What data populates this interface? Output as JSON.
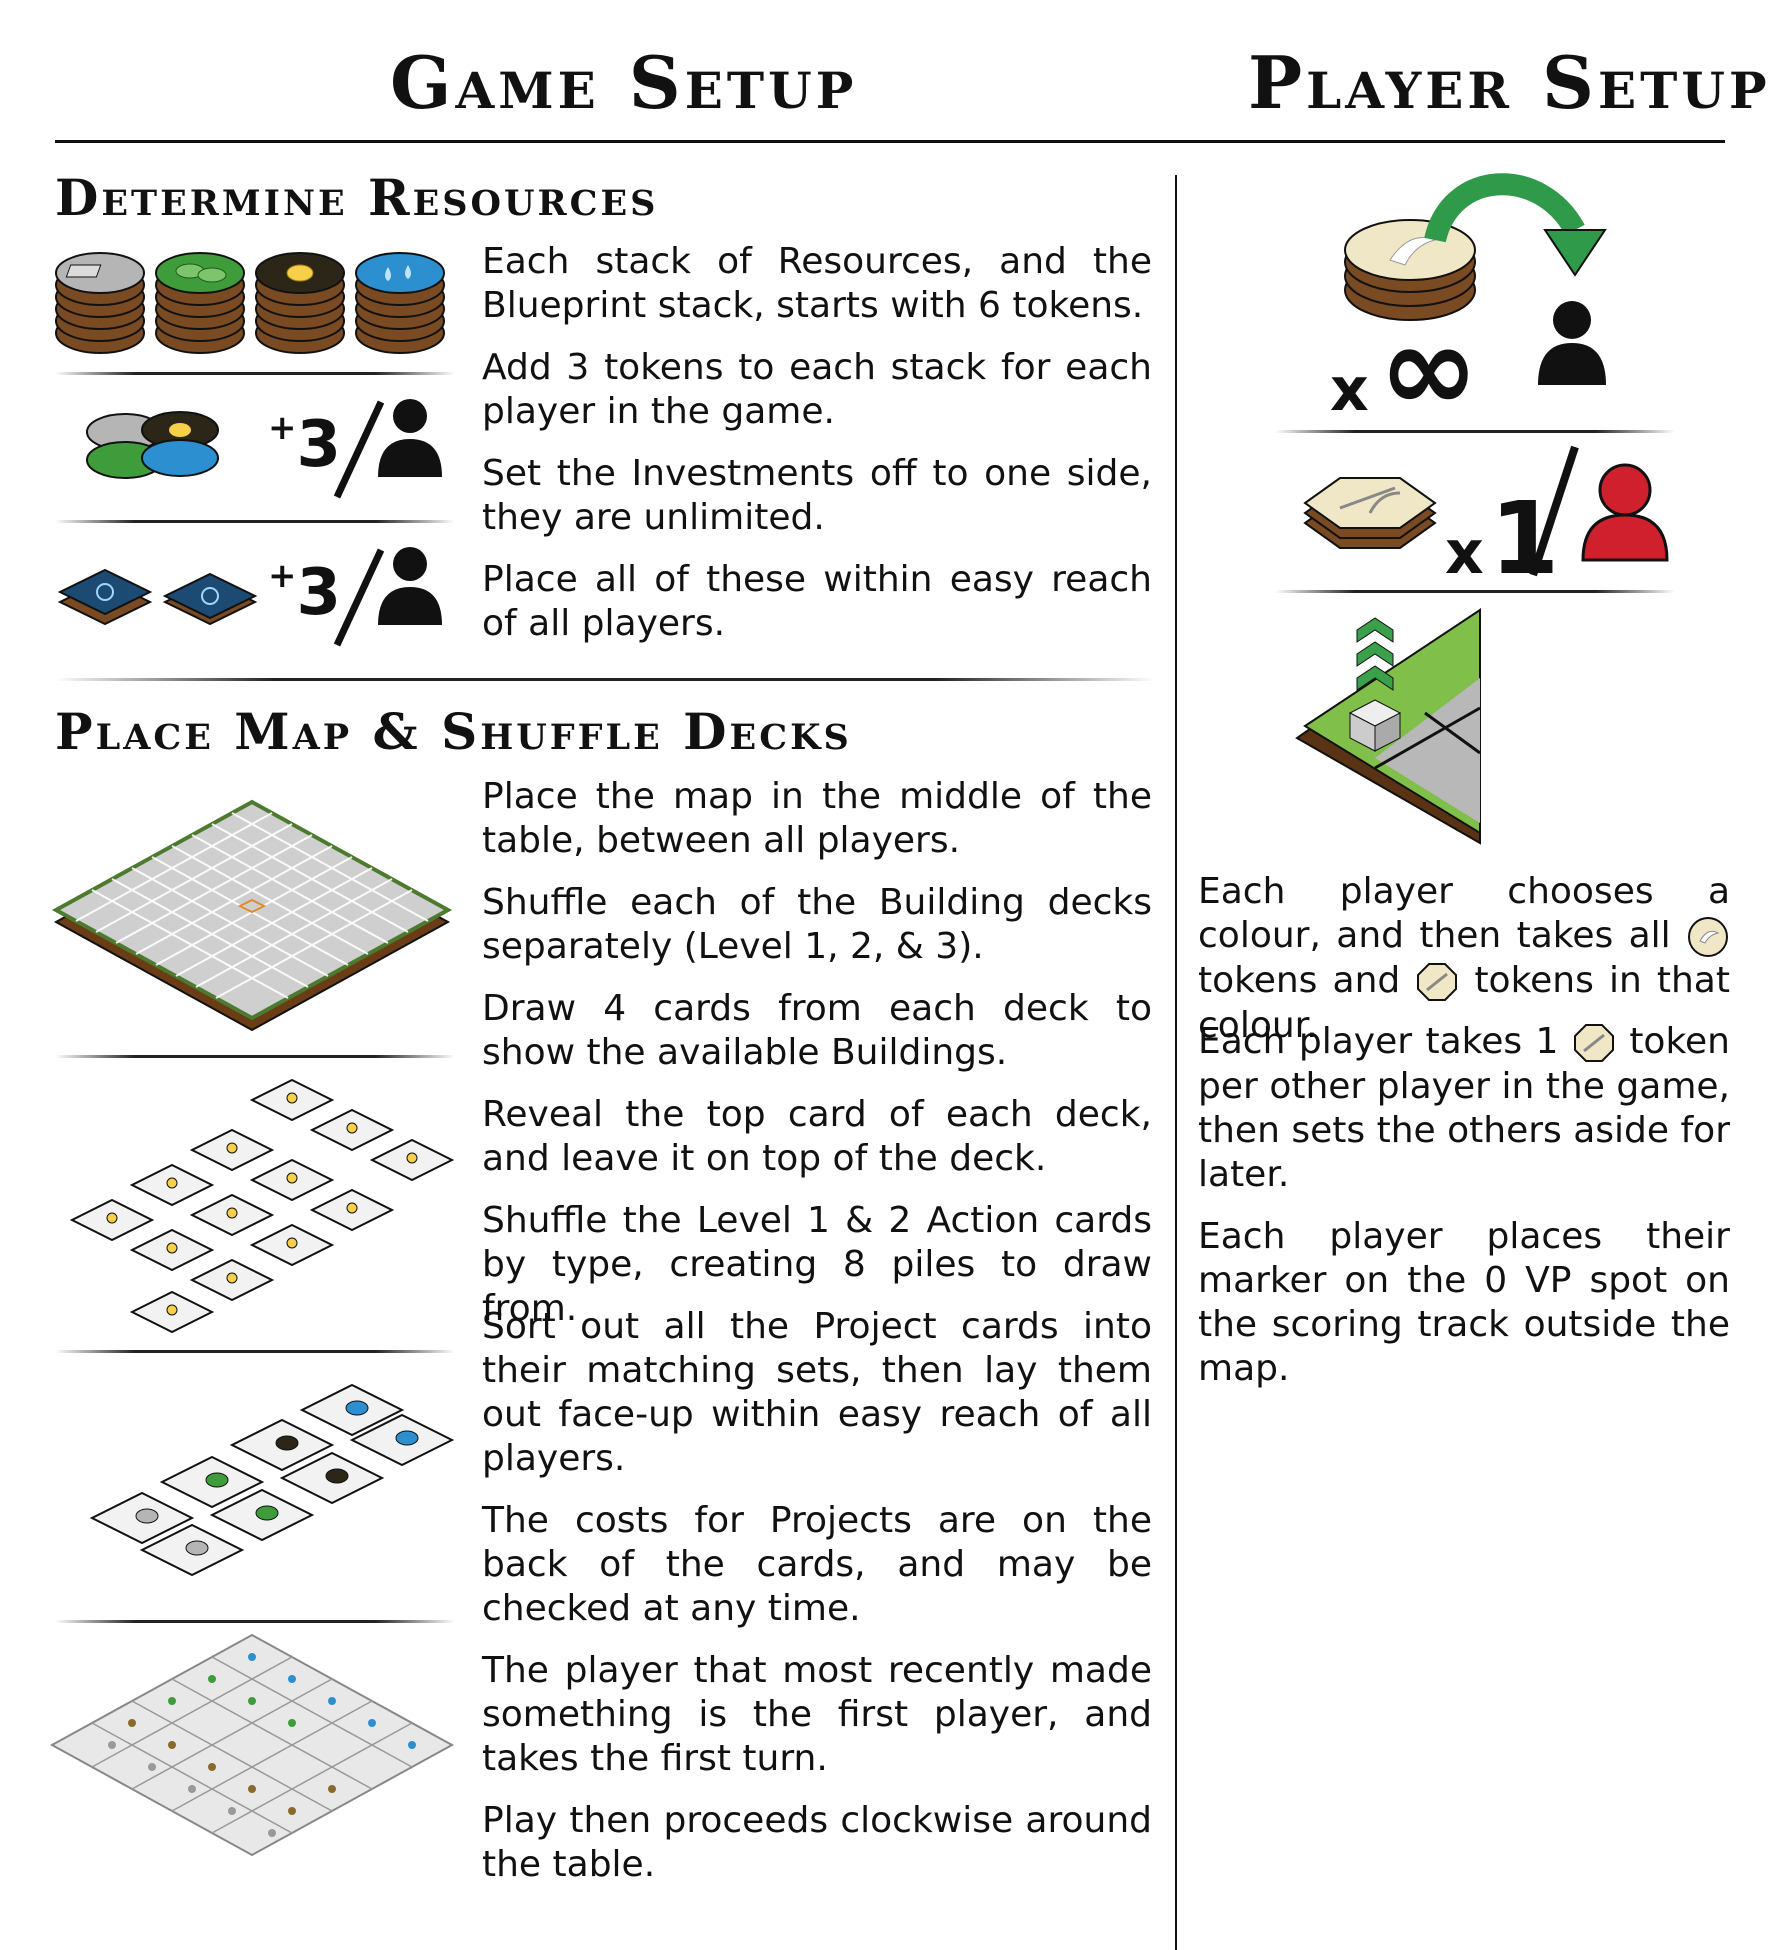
{
  "titles": {
    "game": "Game Setup",
    "player": "Player Setup"
  },
  "sections": {
    "resources": {
      "heading": "Determine Resources",
      "badges": [
        {
          "prefix": "+",
          "number": "3"
        },
        {
          "prefix": "+",
          "number": "3"
        }
      ],
      "paragraphs": [
        "Each stack of Resources, and the Blueprint stack, starts with 6 tokens.",
        "Add 3 tokens to each stack for each player in the game.",
        "Set the Investments off to one side, they are unlimited.",
        "Place all of these within easy reach of all players."
      ]
    },
    "map": {
      "heading": "Place Map & Shuffle Decks",
      "paragraphs": [
        "Place the map in the middle of the table, between all players.",
        "Shuffle each of the Building decks separately (Level 1, 2, & 3).",
        "Draw 4 cards from each deck to show the available Buildings.",
        "Reveal the top card of each deck, and leave it on top of the deck.",
        "Shuffle the Level 1 & 2 Action cards by type, creating 8 piles to draw from.",
        "Sort out all the Project cards into their matching sets, then lay them out face-up within easy reach of all players.",
        "The costs for Projects are on the back of the cards, and may be checked at any time.",
        "The player that most recently made something is the first player, and takes the first turn.",
        "Play then proceeds clockwise around the table."
      ]
    }
  },
  "player_setup": {
    "infinity_prefix": "x",
    "infinity_symbol": "∞",
    "one_prefix": "x",
    "one_number": "1",
    "p1": {
      "a": "Each player chooses a colour, and then takes all",
      "b": "tokens and",
      "c": "tokens in that colour."
    },
    "p2": {
      "a": "Each player takes 1",
      "b": "token per other player in the game, then sets the others aside for later."
    },
    "p3": "Each player places their marker on the 0 VP spot on the scoring track outside the map."
  },
  "colors": {
    "ink": "#111111",
    "arrow_green": "#2e9a4a",
    "player_red": "#d0202e",
    "leaf_green": "#3f9c3a",
    "water_blue": "#2b8fd0",
    "sun_dark": "#2b2618",
    "metal_grey": "#b5b5b5",
    "token_brown": "#7a4a22",
    "blueprint_navy": "#1d4a73",
    "coin_cream": "#efe7c6"
  }
}
